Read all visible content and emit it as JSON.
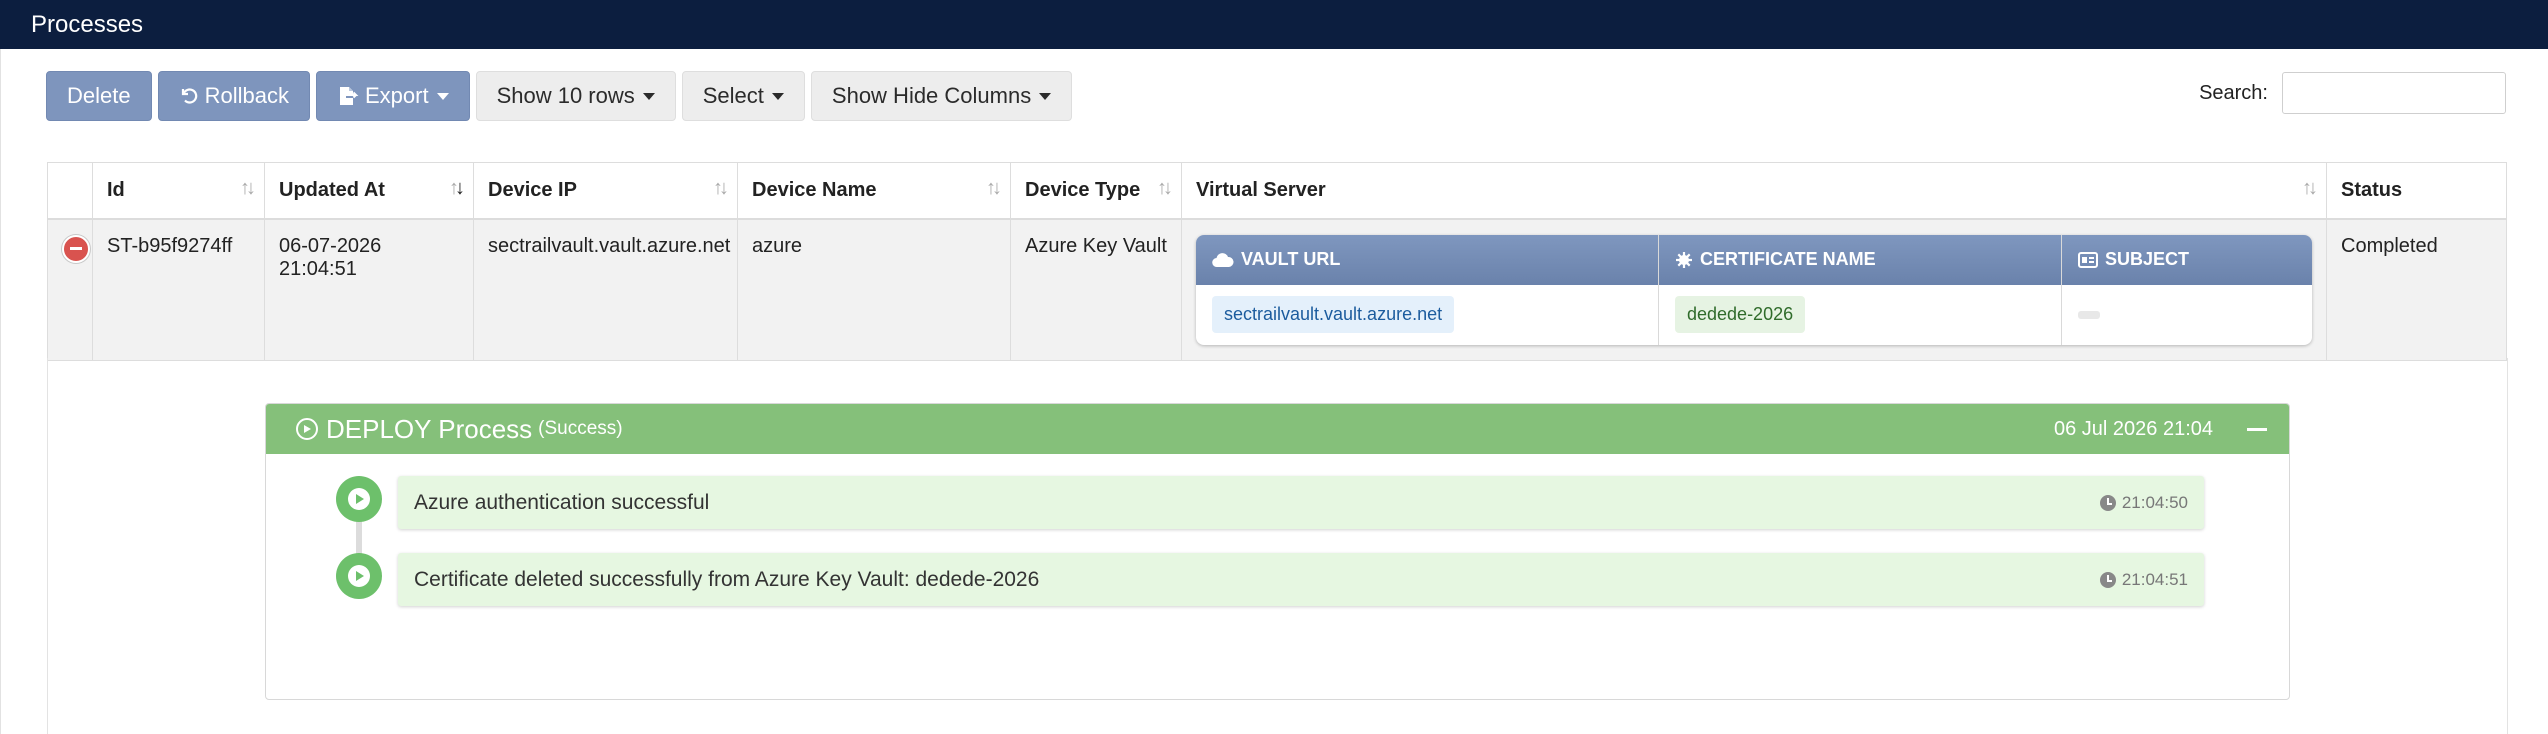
{
  "header": {
    "title": "Processes"
  },
  "toolbar": {
    "delete_label": "Delete",
    "rollback_label": "Rollback",
    "export_label": "Export",
    "rows_label": "Show 10 rows",
    "select_label": "Select",
    "columns_label": "Show Hide Columns"
  },
  "search": {
    "label": "Search:",
    "value": "",
    "placeholder": ""
  },
  "table": {
    "columns": [
      "Id",
      "Updated At",
      "Device IP",
      "Device Name",
      "Device Type",
      "Virtual Server",
      "Status"
    ],
    "row": {
      "id": "ST-b95f9274ff",
      "updated_at": "06-07-2026 21:04:51",
      "device_ip": "sectrailvault.vault.azure.net",
      "device_name": "azure",
      "device_type": "Azure Key Vault",
      "status": "Completed",
      "virtual_server": {
        "headers": {
          "vault_url": "VAULT URL",
          "certificate_name": "CERTIFICATE NAME",
          "subject": "SUBJECT"
        },
        "vault_url": "sectrailvault.vault.azure.net",
        "certificate_name": "dedede-2026",
        "subject": ""
      }
    }
  },
  "process": {
    "title": "DEPLOY Process",
    "status": "(Success)",
    "date": "06 Jul 2026 21:04",
    "events": [
      {
        "message": "Azure authentication successful",
        "time": "21:04:50"
      },
      {
        "message": "Certificate deleted successfully from Azure Key Vault: dedede-2026",
        "time": "21:04:51"
      }
    ]
  },
  "colors": {
    "topbar": "#0c1e3f",
    "primary_button": "#7e95bd",
    "status_completed_bg": "#d9f2d3",
    "process_header": "#85c07a",
    "timeline_node": "#6dc06b",
    "timeline_card": "#e6f7e1"
  },
  "icons": {
    "rollback": "undo-icon",
    "export": "file-export-icon",
    "vault_url": "cloud-icon",
    "certificate_name": "certificate-icon",
    "subject": "id-card-icon",
    "remove_row": "minus-circle-icon",
    "process": "play-circle-icon",
    "event": "play-circle-icon",
    "time": "clock-icon"
  }
}
